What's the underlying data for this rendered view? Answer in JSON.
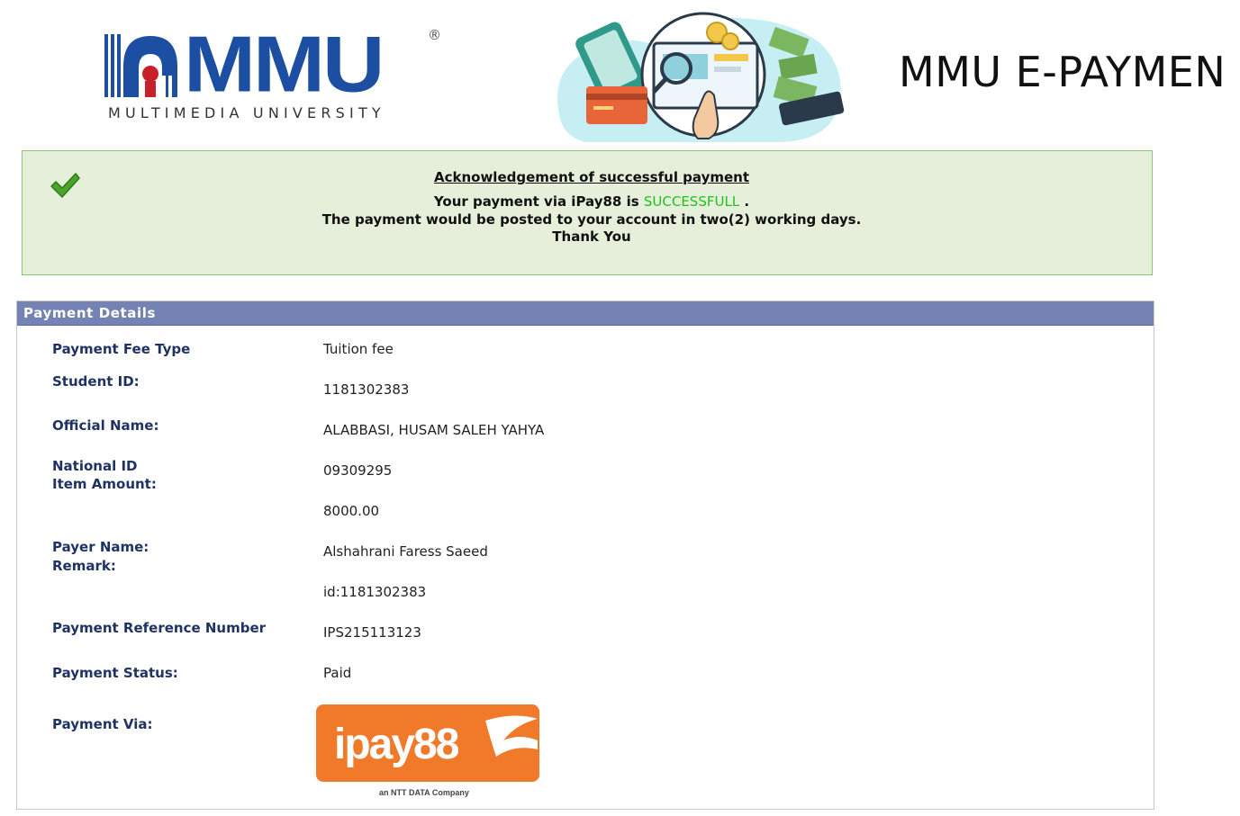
{
  "header": {
    "logo_letters": "MMU",
    "logo_registered": "®",
    "logo_subtitle": "MULTIMEDIA UNIVERSITY",
    "title": "MMU E-PAYMEN"
  },
  "acknowledgement": {
    "title": "Acknowledgement of successful payment",
    "line1_prefix": "Your payment via iPay88 is ",
    "status_word": "SUCCESSFULL",
    "line1_suffix": " .",
    "line2": "The payment would be posted to your account in two(2) working days.",
    "line3": "Thank You"
  },
  "payment_details": {
    "header": "Payment Details",
    "fee_type_label": "Payment Fee Type",
    "fee_type_value": "Tuition fee",
    "student_id_label": "Student ID:",
    "student_id_value": "1181302383",
    "official_name_label": "Official Name:",
    "official_name_value": "ALABBASI, HUSAM SALEH YAHYA",
    "national_id_label": "National ID",
    "national_id_value": "09309295",
    "item_amount_label": "Item Amount:",
    "item_amount_value": "8000.00",
    "payer_name_label": "Payer Name:",
    "payer_name_value": "Alshahrani Faress Saeed",
    "remark_label": "Remark:",
    "remark_value": "id:1181302383",
    "reference_label": "Payment Reference Number",
    "reference_value": "IPS215113123",
    "status_label": "Payment Status:",
    "status_value": "Paid",
    "via_label": "Payment Via:",
    "via_logo_text": "ipay88",
    "via_logo_tagline": "an NTT DATA Company"
  },
  "colors": {
    "success_bg": "#e6efd9",
    "success_border": "#8cc47a",
    "success_green": "#1ec21e",
    "panel_header": "#7582b4",
    "label_navy": "#1f3363",
    "mmu_blue": "#1c4fa1",
    "mmu_red": "#c8202a",
    "ipay_orange": "#f07a2a"
  },
  "icons": {
    "success": "check-icon",
    "illustration": "payment-illustration-icon",
    "university_logo": "mmu-logo-icon",
    "gateway_logo": "ipay88-logo-icon"
  }
}
